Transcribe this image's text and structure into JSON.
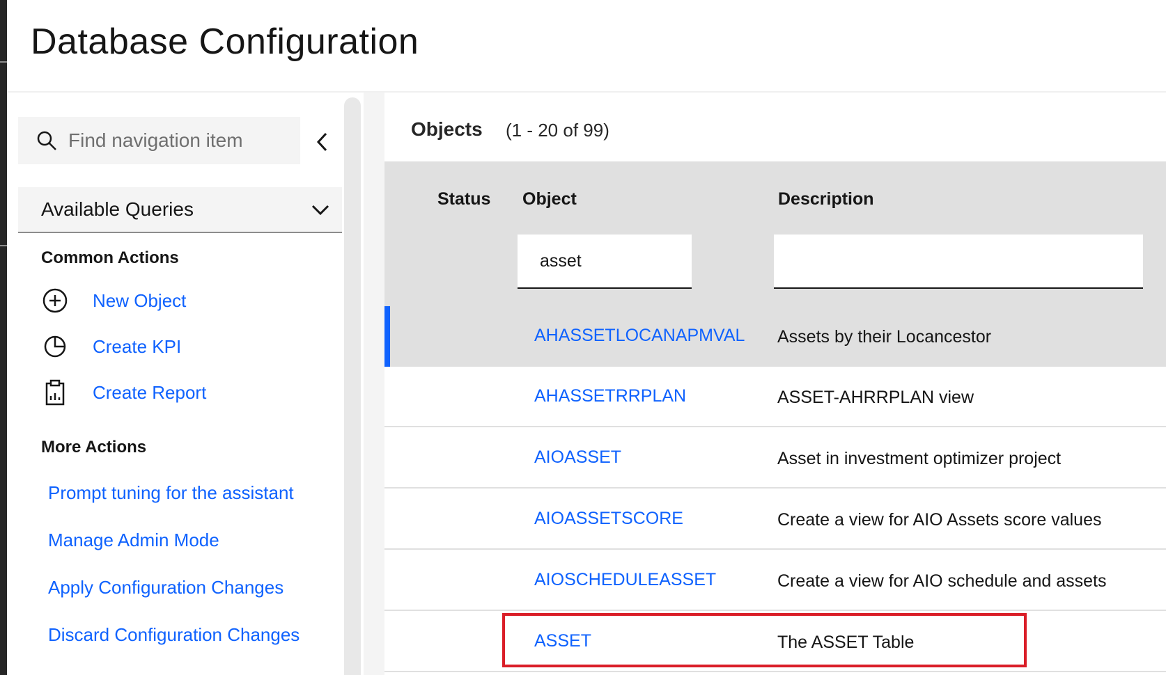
{
  "page": {
    "title": "Database Configuration"
  },
  "sidebar": {
    "search_placeholder": "Find navigation item",
    "dropdown_label": "Available Queries",
    "common_actions": {
      "heading": "Common Actions",
      "items": [
        {
          "label": "New Object",
          "icon": "add-circle-icon"
        },
        {
          "label": "Create KPI",
          "icon": "pie-chart-icon"
        },
        {
          "label": "Create Report",
          "icon": "clipboard-report-icon"
        }
      ]
    },
    "more_actions": {
      "heading": "More Actions",
      "items": [
        {
          "label": "Prompt tuning for the assistant"
        },
        {
          "label": "Manage Admin Mode"
        },
        {
          "label": "Apply Configuration Changes"
        },
        {
          "label": "Discard Configuration Changes"
        }
      ]
    }
  },
  "main": {
    "heading": "Objects",
    "count": "(1 - 20 of 99)",
    "columns": {
      "status": "Status",
      "object": "Object",
      "description": "Description"
    },
    "filters": {
      "object": "asset",
      "description": ""
    },
    "rows": [
      {
        "object": "AHASSETLOCANAPMVAL",
        "description": "Assets by their Locancestor"
      },
      {
        "object": "AHASSETRRPLAN",
        "description": "ASSET-AHRRPLAN view"
      },
      {
        "object": "AIOASSET",
        "description": "Asset in investment optimizer project"
      },
      {
        "object": "AIOASSETSCORE",
        "description": "Create a view for AIO Assets score values"
      },
      {
        "object": "AIOSCHEDULEASSET",
        "description": "Create a view for AIO schedule and assets"
      },
      {
        "object": "ASSET",
        "description": "The ASSET Table"
      }
    ]
  },
  "colors": {
    "link": "#0f62fe",
    "highlight": "#da1e28",
    "selected_bar": "#0f62fe"
  }
}
